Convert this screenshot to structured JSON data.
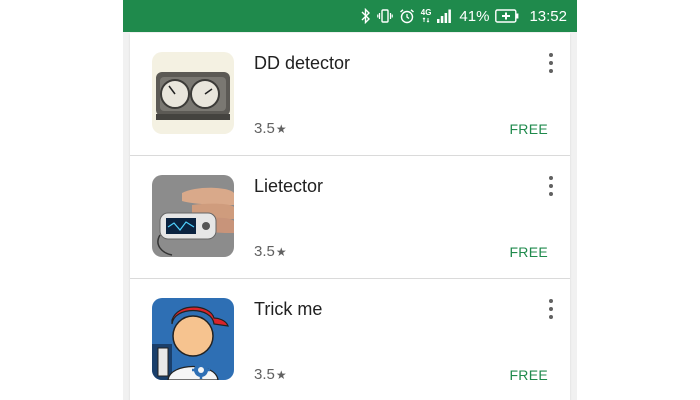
{
  "status_bar": {
    "icons": [
      "bluetooth-icon",
      "vibrate-icon",
      "alarm-icon",
      "network-4g-icon",
      "signal-icon",
      "battery-icon"
    ],
    "network_label": "4G",
    "battery_percent": "41%",
    "battery_charging": true,
    "time": "13:52",
    "background_color": "#1f8a4c"
  },
  "apps": [
    {
      "title": "DD detector",
      "rating": "3.5",
      "price": "FREE",
      "icon": "gauge-detector-icon"
    },
    {
      "title": "Lietector",
      "rating": "3.5",
      "price": "FREE",
      "icon": "finger-sensor-icon"
    },
    {
      "title": "Trick me",
      "rating": "3.5",
      "price": "FREE",
      "icon": "cartoon-kid-icon"
    }
  ],
  "colors": {
    "accent": "#1f8a4c",
    "text": "#212121",
    "muted": "#616161"
  }
}
